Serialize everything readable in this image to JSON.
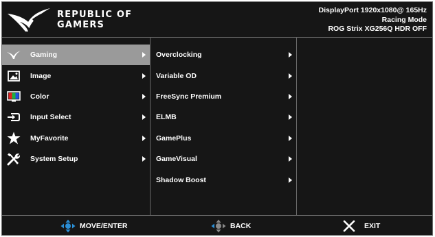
{
  "brand": {
    "line1": "REPUBLIC OF",
    "line2": "GAMERS"
  },
  "status": {
    "line1": "DisplayPort  1920x1080@  165Hz",
    "line2": "Racing Mode",
    "line3": "ROG Strix XG256Q   HDR OFF"
  },
  "main_menu": [
    {
      "label": "Gaming",
      "icon": "rog-eye-icon",
      "selected": true
    },
    {
      "label": "Image",
      "icon": "image-icon",
      "selected": false
    },
    {
      "label": "Color",
      "icon": "color-icon",
      "selected": false
    },
    {
      "label": "Input Select",
      "icon": "input-icon",
      "selected": false
    },
    {
      "label": "MyFavorite",
      "icon": "star-icon",
      "selected": false
    },
    {
      "label": "System Setup",
      "icon": "tools-icon",
      "selected": false
    }
  ],
  "sub_menu": [
    {
      "label": "Overclocking"
    },
    {
      "label": "Variable OD"
    },
    {
      "label": "FreeSync Premium"
    },
    {
      "label": "ELMB"
    },
    {
      "label": "GamePlus"
    },
    {
      "label": "GameVisual"
    },
    {
      "label": "Shadow Boost"
    }
  ],
  "footer": {
    "move": "MOVE/ENTER",
    "back": "BACK",
    "exit": "EXIT"
  },
  "colors": {
    "background": "#161616",
    "selected": "#9a9a9a",
    "accent_blue": "#2b8fd6",
    "divider": "#6a6a6a"
  }
}
